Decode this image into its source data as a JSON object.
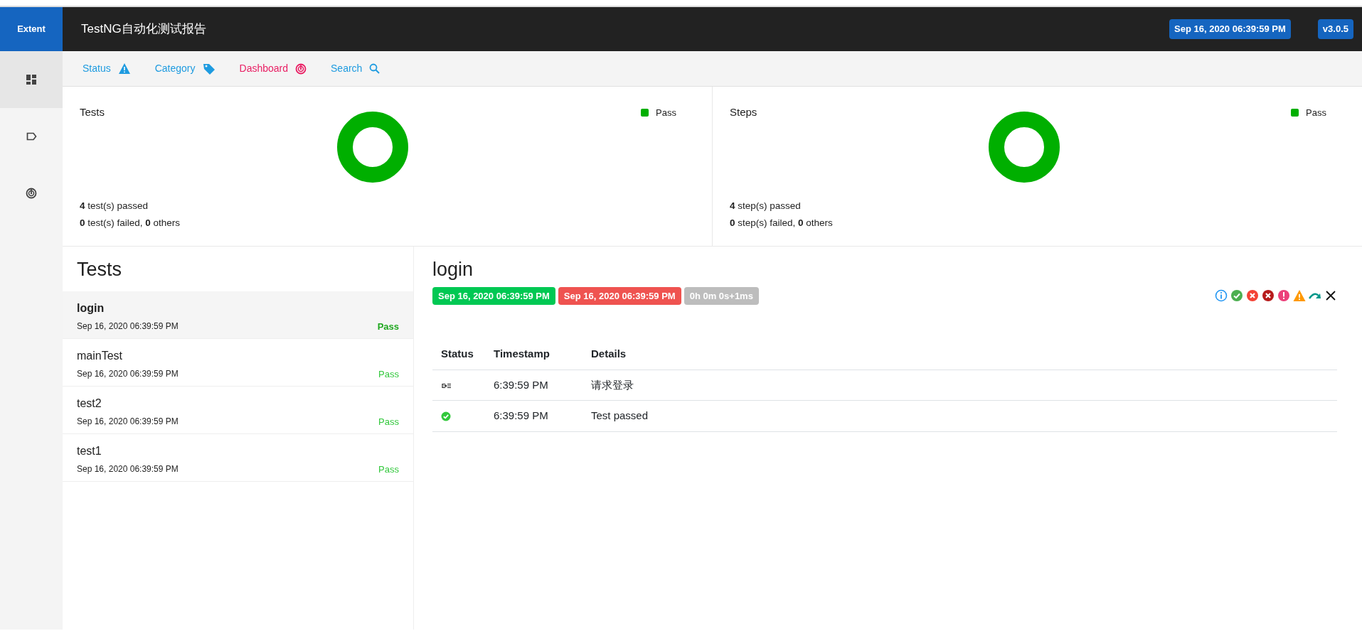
{
  "header": {
    "logo": "Extent",
    "title": "TestNG自动化测试报告",
    "badges": [
      "Sep 16, 2020 06:39:59 PM",
      "v3.0.5"
    ]
  },
  "sidebar": {
    "items": [
      {
        "kind": "dashboard",
        "selected": true
      },
      {
        "kind": "tag",
        "selected": false
      },
      {
        "kind": "radar",
        "selected": false
      }
    ]
  },
  "subnav": [
    {
      "label": "Status",
      "kind": "warning",
      "selected": false
    },
    {
      "label": "Category",
      "kind": "tag",
      "selected": false
    },
    {
      "label": "Dashboard",
      "kind": "radar",
      "selected": true
    },
    {
      "label": "Search",
      "kind": "search",
      "selected": false
    }
  ],
  "summary_panels": [
    {
      "title": "Tests",
      "legend": [
        {
          "label": "Pass",
          "color": "#00af00"
        }
      ],
      "lines": [
        "**4** test(s) passed",
        "**0** test(s) failed, **0** others"
      ]
    },
    {
      "title": "Steps",
      "legend": [
        {
          "label": "Pass",
          "color": "#00af00"
        }
      ],
      "lines": [
        "**4** step(s) passed",
        "**0** step(s) failed, **0** others"
      ]
    }
  ],
  "test_list": {
    "title": "Tests",
    "items": [
      {
        "name": "login",
        "time": "Sep 16, 2020 06:39:59 PM",
        "status": "Pass",
        "selected": true
      },
      {
        "name": "mainTest",
        "time": "Sep 16, 2020 06:39:59 PM",
        "status": "Pass",
        "selected": false
      },
      {
        "name": "test2",
        "time": "Sep 16, 2020 06:39:59 PM",
        "status": "Pass",
        "selected": false
      },
      {
        "name": "test1",
        "time": "Sep 16, 2020 06:39:59 PM",
        "status": "Pass",
        "selected": false
      }
    ]
  },
  "detail": {
    "title": "login",
    "badges": [
      {
        "kind": "start",
        "text": "Sep 16, 2020 06:39:59 PM"
      },
      {
        "kind": "end",
        "text": "Sep 16, 2020 06:39:59 PM"
      },
      {
        "kind": "duration",
        "text": "0h 0m 0s+1ms"
      }
    ],
    "filters": [
      {
        "kind": "info"
      },
      {
        "kind": "pass"
      },
      {
        "kind": "fail"
      },
      {
        "kind": "fatal"
      },
      {
        "kind": "error"
      },
      {
        "kind": "warning"
      },
      {
        "kind": "skip"
      },
      {
        "kind": "clear"
      }
    ],
    "table": {
      "columns": [
        "Status",
        "Timestamp",
        "Details"
      ],
      "rows": [
        {
          "kind": "info",
          "timestamp": "6:39:59 PM",
          "details": "请求登录"
        },
        {
          "kind": "pass",
          "timestamp": "6:39:59 PM",
          "details": "Test passed"
        }
      ]
    }
  }
}
